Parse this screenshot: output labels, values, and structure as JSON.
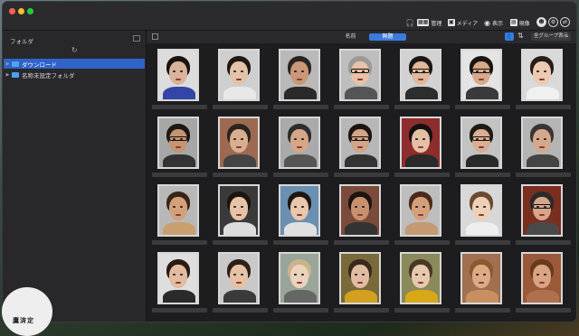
{
  "window": {
    "lights": [
      "#ff5f57",
      "#febc2e",
      "#28c840"
    ]
  },
  "toolbar": {
    "buttons": [
      {
        "label": "管理",
        "icon": "grid-icon"
      },
      {
        "label": "メディア",
        "icon": "media-icon"
      },
      {
        "label": "表示",
        "icon": "eye-icon"
      },
      {
        "label": "現像",
        "icon": "develop-icon"
      }
    ]
  },
  "sidebar": {
    "header": "フォルダ",
    "folders": [
      {
        "label": "ダウンロード",
        "selected": true
      },
      {
        "label": "名称未設定フォルダ",
        "selected": false
      }
    ]
  },
  "main": {
    "tabs": [
      {
        "label": "名前",
        "active": false
      },
      {
        "label": "無題",
        "active": true
      }
    ],
    "dropdown": "全グループ表示"
  },
  "faces": [
    {
      "skin": "#d9b39a",
      "hair": "#1a1410",
      "bg": "#dcdcdc",
      "shirt": "#3346a8",
      "glasses": false
    },
    {
      "skin": "#e3c3a8",
      "hair": "#201812",
      "bg": "#cfcfcf",
      "shirt": "#e8e8e8",
      "glasses": false
    },
    {
      "skin": "#c89878",
      "hair": "#2a2420",
      "bg": "#b9b9b9",
      "shirt": "#2a2a2a",
      "glasses": false
    },
    {
      "skin": "#e7c2a8",
      "hair": "#9a9a9a",
      "bg": "#bebebe",
      "shirt": "#555",
      "glasses": true
    },
    {
      "skin": "#e0b89c",
      "hair": "#1c1613",
      "bg": "#d2d2d2",
      "shirt": "#2d2d2d",
      "glasses": true
    },
    {
      "skin": "#d6a98a",
      "hair": "#1a1511",
      "bg": "#e4e4e4",
      "shirt": "#3a3a3a",
      "glasses": true
    },
    {
      "skin": "#ecc9b0",
      "hair": "#2a1d16",
      "bg": "#d9d9d9",
      "shirt": "#f0f0f0",
      "glasses": false
    },
    {
      "skin": "#c59472",
      "hair": "#1e1712",
      "bg": "#a7a7a7",
      "shirt": "#333",
      "glasses": true
    },
    {
      "skin": "#d8ad90",
      "hair": "#2a2420",
      "bg": "#9c6a50",
      "shirt": "#444",
      "glasses": false
    },
    {
      "skin": "#d5a688",
      "hair": "#2d2d2d",
      "bg": "#aaa",
      "shirt": "#555",
      "glasses": false
    },
    {
      "skin": "#d2a488",
      "hair": "#1b1512",
      "bg": "#b7b7b7",
      "shirt": "#333",
      "glasses": true
    },
    {
      "skin": "#e4bfa4",
      "hair": "#141010",
      "bg": "#8d2d2d",
      "shirt": "#2a2a2a",
      "glasses": false
    },
    {
      "skin": "#d9ae94",
      "hair": "#201a16",
      "bg": "#c3c3c3",
      "shirt": "#2a2a2a",
      "glasses": true
    },
    {
      "skin": "#d4a88c",
      "hair": "#3a3434",
      "bg": "#b4b4b4",
      "shirt": "#444",
      "glasses": false
    },
    {
      "skin": "#d2a17c",
      "hair": "#3a2418",
      "bg": "#b8b8b8",
      "shirt": "#c8a070",
      "glasses": false
    },
    {
      "skin": "#e6c3a6",
      "hair": "#1c1410",
      "bg": "#3a3a3a",
      "shirt": "#ddd",
      "glasses": false
    },
    {
      "skin": "#e8c7aa",
      "hair": "#1d1712",
      "bg": "#6a8fb0",
      "shirt": "#e0e0e0",
      "glasses": false
    },
    {
      "skin": "#c79170",
      "hair": "#1d1410",
      "bg": "#7a4a3a",
      "shirt": "#333",
      "glasses": false
    },
    {
      "skin": "#d4a07c",
      "hair": "#4a2a1a",
      "bg": "#bdbdbd",
      "shirt": "#c49a72",
      "glasses": false
    },
    {
      "skin": "#ecd0b8",
      "hair": "#6a4a30",
      "bg": "#d8d8d8",
      "shirt": "#eee",
      "glasses": false
    },
    {
      "skin": "#d6a58a",
      "hair": "#2a2a2a",
      "bg": "#7a2e20",
      "shirt": "#4a4a4a",
      "glasses": true
    },
    {
      "skin": "#e2bba0",
      "hair": "#2a1c14",
      "bg": "#dedede",
      "shirt": "#2a2a2a",
      "glasses": false
    },
    {
      "skin": "#e6c1a6",
      "hair": "#2e1f16",
      "bg": "#c9c9c9",
      "shirt": "#3a3a3a",
      "glasses": false
    },
    {
      "skin": "#ead2bc",
      "hair": "#c9b48a",
      "bg": "#9aa59a",
      "shirt": "#666",
      "glasses": false
    },
    {
      "skin": "#e0bca2",
      "hair": "#3a2a1e",
      "bg": "#7a6a3a",
      "shirt": "#d4a020",
      "glasses": false
    },
    {
      "skin": "#e6c8ae",
      "hair": "#4a3826",
      "bg": "#8a8a5a",
      "shirt": "#d8a818",
      "glasses": false
    },
    {
      "skin": "#dcaa86",
      "hair": "#8a5a30",
      "bg": "#a07050",
      "shirt": "#c89060",
      "glasses": false
    },
    {
      "skin": "#d8a482",
      "hair": "#6a3a1e",
      "bg": "#9a5a3a",
      "shirt": "#b07050",
      "glasses": false
    }
  ],
  "watermark": {
    "text": "鷹済定"
  }
}
